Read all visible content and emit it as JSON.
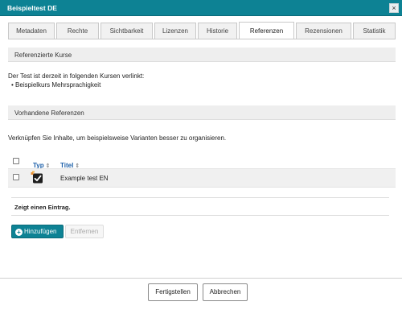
{
  "dialog": {
    "title": "Beispieltest DE",
    "close_icon": "close-icon"
  },
  "tabs": [
    {
      "label": "Metadaten"
    },
    {
      "label": "Rechte"
    },
    {
      "label": "Sichtbarkeit"
    },
    {
      "label": "Lizenzen"
    },
    {
      "label": "Historie"
    },
    {
      "label": "Referenzen",
      "active": true
    },
    {
      "label": "Rezensionen"
    },
    {
      "label": "Statistik"
    }
  ],
  "referenced_courses": {
    "heading": "Referenzierte Kurse",
    "intro": "Der Test ist derzeit in folgenden Kursen verlinkt:",
    "items": [
      "Beispielkurs Mehrsprachigkeit"
    ]
  },
  "existing_references": {
    "heading": "Vorhandene Referenzen",
    "intro": "Verknüpfen Sie Inhalte, um beispielsweise Varianten besser zu organisieren.",
    "table": {
      "columns": [
        "Typ",
        "Titel"
      ],
      "sort_icon": "sort-icon",
      "rows": [
        {
          "type_icon": "test-checkbox-icon",
          "title": "Example test EN"
        }
      ]
    },
    "footer": "Zeigt einen Eintrag.",
    "add_button": "Hinzufügen",
    "remove_button": "Entfernen"
  },
  "buttons": {
    "finish": "Fertigstellen",
    "cancel": "Abbrechen"
  },
  "colors": {
    "accent": "#0d8294",
    "link": "#1a5ea8"
  }
}
